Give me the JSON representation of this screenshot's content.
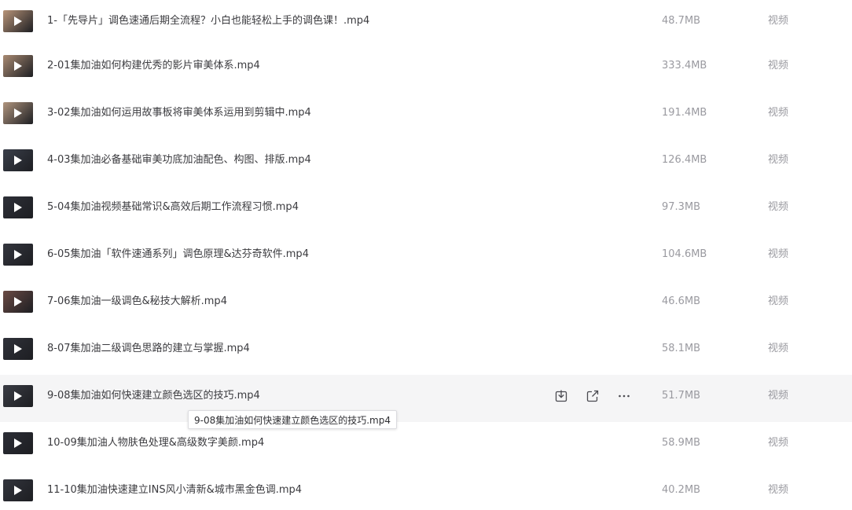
{
  "files": [
    {
      "name": "1-「先导片」调色速通后期全流程？小白也能轻松上手的调色课！.mp4",
      "size": "48.7MB",
      "type": "视频",
      "thumb_icon": "video-thumbnail-person",
      "thumb_color": "#b89478"
    },
    {
      "name": "2-01集加油如何构建优秀的影片审美体系.mp4",
      "size": "333.4MB",
      "type": "视频",
      "thumb_icon": "video-thumbnail-person",
      "thumb_color": "#a98a72"
    },
    {
      "name": "3-02集加油如何运用故事板将审美体系运用到剪辑中.mp4",
      "size": "191.4MB",
      "type": "视频",
      "thumb_icon": "video-thumbnail-person",
      "thumb_color": "#b0957e"
    },
    {
      "name": "4-03集加油必备基础审美功底加油配色、构图、排版.mp4",
      "size": "126.4MB",
      "type": "视频",
      "thumb_icon": "video-thumbnail-screen",
      "thumb_color": "#3a3f4a"
    },
    {
      "name": "5-04集加油视频基础常识&高效后期工作流程习惯.mp4",
      "size": "97.3MB",
      "type": "视频",
      "thumb_icon": "video-thumbnail-screen",
      "thumb_color": "#2e3038"
    },
    {
      "name": "6-05集加油「软件速通系列」调色原理&达芬奇软件.mp4",
      "size": "104.6MB",
      "type": "视频",
      "thumb_icon": "video-thumbnail-screen",
      "thumb_color": "#34363e"
    },
    {
      "name": "7-06集加油一级调色&秘技大解析.mp4",
      "size": "46.6MB",
      "type": "视频",
      "thumb_icon": "video-thumbnail-screen",
      "thumb_color": "#6a4a44"
    },
    {
      "name": "8-07集加油二级调色思路的建立与掌握.mp4",
      "size": "58.1MB",
      "type": "视频",
      "thumb_icon": "video-thumbnail-screen",
      "thumb_color": "#30323a"
    },
    {
      "name": "9-08集加油如何快速建立颜色选区的技巧.mp4",
      "size": "51.7MB",
      "type": "视频",
      "thumb_icon": "video-thumbnail-screen",
      "thumb_color": "#3a3c44"
    },
    {
      "name": "10-09集加油人物肤色处理&高级数字美颜.mp4",
      "size": "58.9MB",
      "type": "视频",
      "thumb_icon": "video-thumbnail-screen",
      "thumb_color": "#2c2e36"
    },
    {
      "name": "11-10集加油快速建立INS风小清新&城市黑金色调.mp4",
      "size": "40.2MB",
      "type": "视频",
      "thumb_icon": "video-thumbnail-screen",
      "thumb_color": "#33353d"
    }
  ],
  "hovered_row": 8,
  "hover_actions": {
    "download_icon": "download-icon",
    "share_icon": "share-icon",
    "more_icon": "more-icon"
  },
  "tooltip": {
    "text": "9-08集加油如何快速建立颜色选区的技巧.mp4"
  }
}
